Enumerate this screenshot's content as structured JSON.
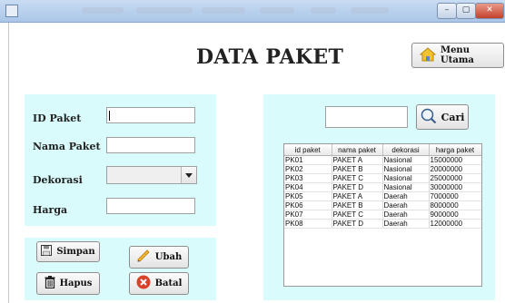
{
  "window": {
    "controls": {
      "minimize": "–",
      "maximize": "▢",
      "close": "✕"
    }
  },
  "header": {
    "title": "DATA PAKET",
    "menu_button": "Menu Utama"
  },
  "form": {
    "labels": {
      "id": "ID Paket",
      "nama": "Nama Paket",
      "dekorasi": "Dekorasi",
      "harga": "Harga"
    },
    "values": {
      "id": "",
      "nama": "",
      "harga": ""
    },
    "dekorasi_selected": ""
  },
  "buttons": {
    "simpan": "Simpan",
    "ubah": "Ubah",
    "hapus": "Hapus",
    "batal": "Batal",
    "cari": "Cari"
  },
  "search": {
    "value": ""
  },
  "table": {
    "columns": [
      "id paket",
      "nama paket",
      "dekorasi",
      "harga paket"
    ],
    "rows": [
      [
        "PK01",
        "PAKET A",
        "Nasional",
        "15000000"
      ],
      [
        "PK02",
        "PAKET B",
        "Nasional",
        "20000000"
      ],
      [
        "PK03",
        "PAKET C",
        "Nasional",
        "25000000"
      ],
      [
        "PK04",
        "PAKET D",
        "Nasional",
        "30000000"
      ],
      [
        "PK05",
        "PAKET A",
        "Daerah",
        "7000000"
      ],
      [
        "PK06",
        "PAKET B",
        "Daerah",
        "8000000"
      ],
      [
        "PK07",
        "PAKET C",
        "Daerah",
        "9000000"
      ],
      [
        "PK08",
        "PAKET D",
        "Daerah",
        "12000000"
      ]
    ]
  },
  "colors": {
    "panel_bg": "#d9fbfb",
    "accent_close": "#c2412c"
  }
}
